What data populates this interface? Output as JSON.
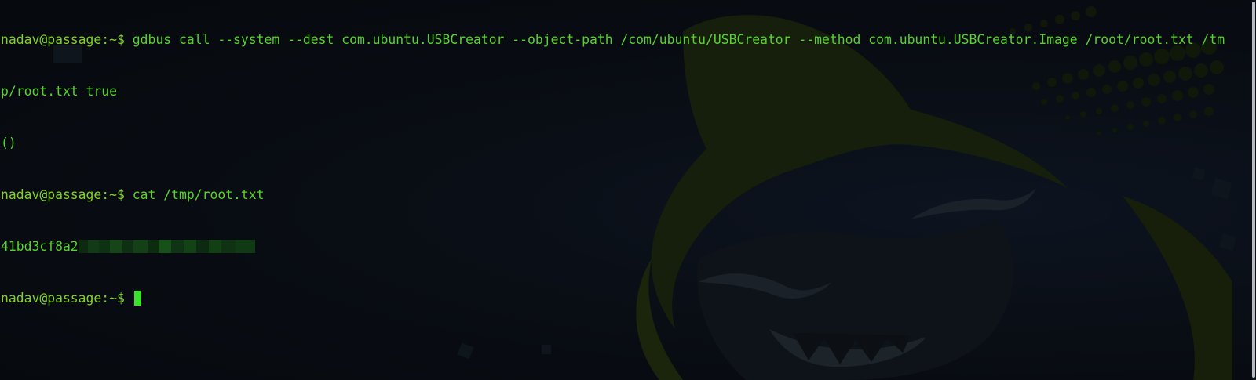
{
  "terminal": {
    "lines": [
      {
        "prompt": "nadav@passage:~$ ",
        "text": "gdbus call --system --dest com.ubuntu.USBCreator --object-path /com/ubuntu/USBCreator --method com.ubuntu.USBCreator.Image /root/root.txt /tm"
      },
      {
        "prompt": "",
        "text": "p/root.txt true"
      },
      {
        "prompt": "",
        "text": "()"
      },
      {
        "prompt": "nadav@passage:~$ ",
        "text": "cat /tmp/root.txt"
      },
      {
        "prompt": "",
        "text": "41bd3cf8a2"
      },
      {
        "prompt": "nadav@passage:~$ ",
        "text": ""
      }
    ]
  },
  "colors": {
    "background": "#070b10",
    "prompt": "#80d22a",
    "command": "#57d32d",
    "cursor": "#39e22b",
    "wallpaper_accent": "#1c2a0c"
  },
  "icons": {
    "wallpaper": "hooded-hacker-mascot-icon"
  }
}
